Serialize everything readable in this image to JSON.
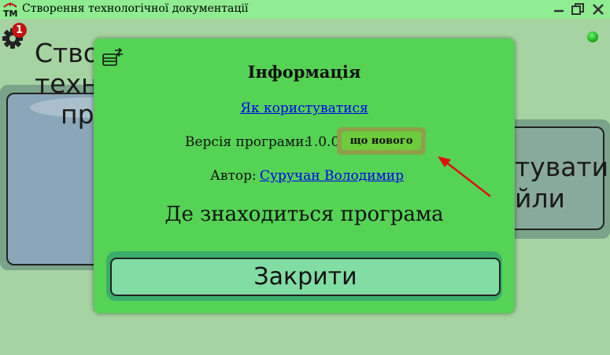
{
  "window": {
    "title": "Створення технологічної документації",
    "logo_text": "ТМ"
  },
  "toolbar": {
    "settings_badge": "1"
  },
  "background_cards": {
    "left_text_lines": [
      "Ство",
      "техноло",
      "про"
    ],
    "right_text_lines": [
      "тувати",
      "йли"
    ]
  },
  "dialog": {
    "title": "Інформація",
    "how_to_link": "Як користуватися",
    "version_label": "Версія програми:",
    "version_value": "1.0.0",
    "whats_new_button": "що нового",
    "author_label": "Автор:",
    "author_name": "Суручан Володимир",
    "where_text": "Де знаходиться програма",
    "close_button": "Закрити"
  },
  "colors": {
    "dialog_bg": "#55d355",
    "titlebar_bg": "#90ec90",
    "highlight_ring": "#8fa04a",
    "arrow": "#e01010",
    "status_led": "#13a513"
  }
}
